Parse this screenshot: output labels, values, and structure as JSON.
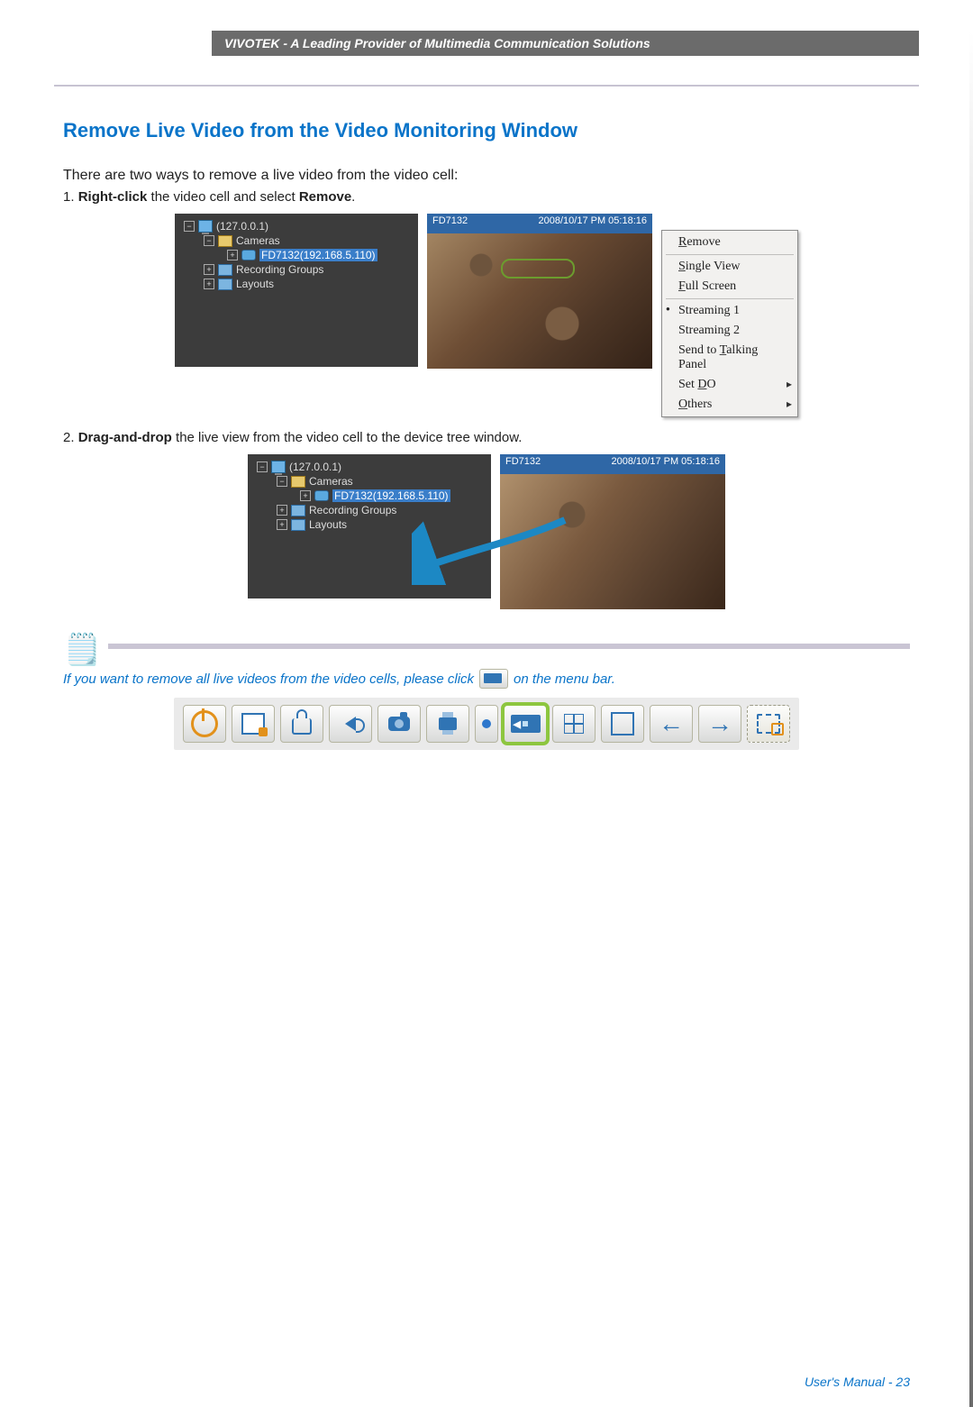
{
  "header": {
    "brand_line": "VIVOTEK - A Leading Provider of Multimedia Communication Solutions"
  },
  "page": {
    "title": "Remove Live Video from the Video Monitoring Window",
    "lead": "There are two ways to remove a live video from the video cell:",
    "step1_prefix": "1. ",
    "step1_bold1": "Right-click",
    "step1_mid": " the video cell and select ",
    "step1_bold2": "Remove",
    "step1_end": ".",
    "step2_prefix": "2. ",
    "step2_bold1": "Drag-and-drop",
    "step2_end": " the live view from the video cell to the device tree window."
  },
  "tree": {
    "root": "(127.0.0.1)",
    "cameras": "Cameras",
    "camera_item": "FD7132(192.168.5.110)",
    "recgroups": "Recording Groups",
    "layouts": "Layouts"
  },
  "video": {
    "camname": "FD7132",
    "timestamp": "2008/10/17 PM 05:18:16"
  },
  "context_menu": {
    "remove": "Remove",
    "single_view": "Single View",
    "full_screen": "Full Screen",
    "streaming1": "Streaming 1",
    "streaming2": "Streaming 2",
    "send_talk": "Send to Talking Panel",
    "set_do": "Set DO",
    "others": "Others"
  },
  "note": {
    "tip_before": "If you want to remove all live videos from the video cells, please click ",
    "tip_after": " on the menu bar."
  },
  "footer": {
    "text": "User's Manual - 23"
  }
}
